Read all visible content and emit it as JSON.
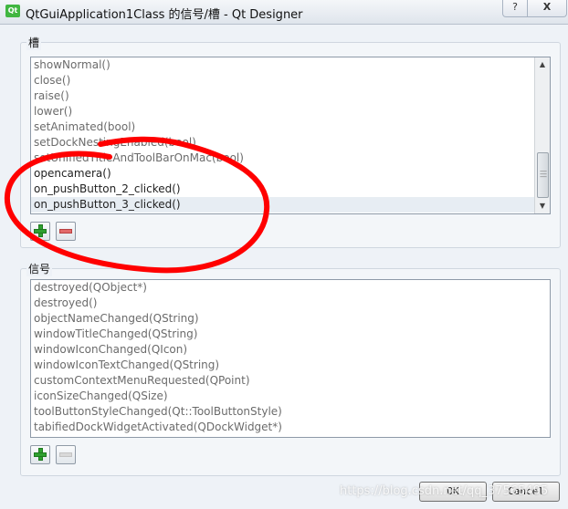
{
  "window": {
    "icon_text": "Qt",
    "title": "QtGuiApplication1Class 的信号/槽 - Qt Designer",
    "help_label": "?",
    "close_label": "X"
  },
  "slots": {
    "label": "槽",
    "items": [
      {
        "text": "showNormal()",
        "inherited": true
      },
      {
        "text": "close()",
        "inherited": true
      },
      {
        "text": "raise()",
        "inherited": true
      },
      {
        "text": "lower()",
        "inherited": true
      },
      {
        "text": "setAnimated(bool)",
        "inherited": true
      },
      {
        "text": "setDockNestingEnabled(bool)",
        "inherited": true
      },
      {
        "text": "setUnifiedTitleAndToolBarOnMac(bool)",
        "inherited": true
      },
      {
        "text": "opencamera()",
        "inherited": false
      },
      {
        "text": "on_pushButton_2_clicked()",
        "inherited": false
      },
      {
        "text": "on_pushButton_3_clicked()",
        "inherited": false,
        "selected": true
      }
    ]
  },
  "signals": {
    "label": "信号",
    "items": [
      {
        "text": "destroyed(QObject*)",
        "inherited": true
      },
      {
        "text": "destroyed()",
        "inherited": true
      },
      {
        "text": "objectNameChanged(QString)",
        "inherited": true
      },
      {
        "text": "windowTitleChanged(QString)",
        "inherited": true
      },
      {
        "text": "windowIconChanged(QIcon)",
        "inherited": true
      },
      {
        "text": "windowIconTextChanged(QString)",
        "inherited": true
      },
      {
        "text": "customContextMenuRequested(QPoint)",
        "inherited": true
      },
      {
        "text": "iconSizeChanged(QSize)",
        "inherited": true
      },
      {
        "text": "toolButtonStyleChanged(Qt::ToolButtonStyle)",
        "inherited": true
      },
      {
        "text": "tabifiedDockWidgetActivated(QDockWidget*)",
        "inherited": true
      }
    ]
  },
  "buttons": {
    "ok": "OK",
    "cancel": "Cancel"
  },
  "watermark": "https://blog.csdn.net/qq_37565495",
  "colors": {
    "annotation": "#ff0000",
    "add_icon": "#2fa02f",
    "remove_icon": "#e36a6a"
  }
}
